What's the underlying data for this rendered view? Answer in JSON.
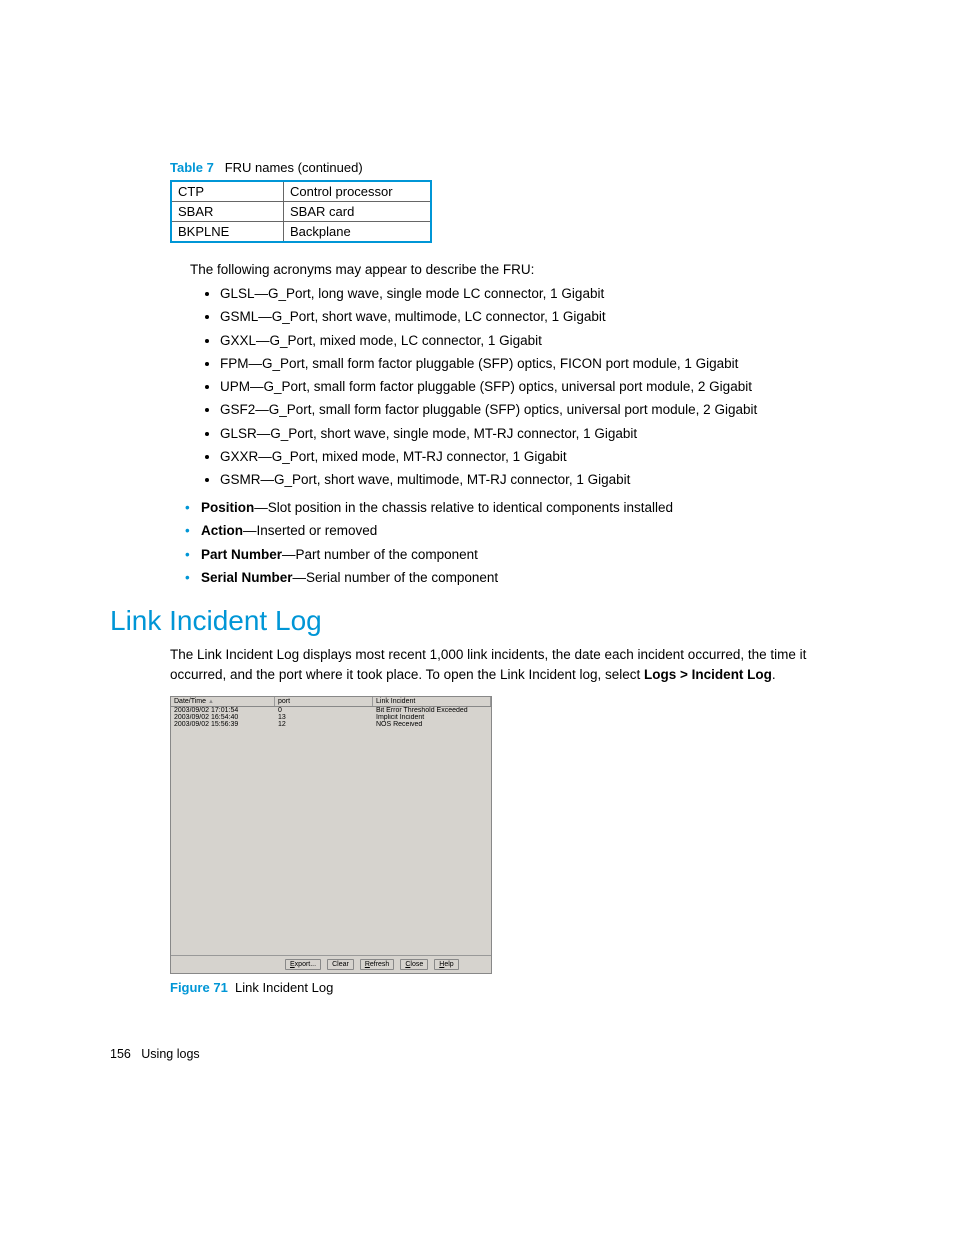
{
  "table": {
    "label": "Table 7",
    "title": "FRU names  (continued)",
    "rows": [
      {
        "k": "CTP",
        "v": "Control processor"
      },
      {
        "k": "SBAR",
        "v": "SBAR card"
      },
      {
        "k": "BKPLNE",
        "v": "Backplane"
      }
    ]
  },
  "intro": "The following acronyms may appear to describe the FRU:",
  "acronyms": [
    "GLSL—G_Port, long wave, single mode LC connector, 1 Gigabit",
    "GSML—G_Port, short wave, multimode, LC connector, 1 Gigabit",
    "GXXL—G_Port, mixed mode, LC connector, 1 Gigabit",
    "FPM—G_Port, small form factor pluggable (SFP) optics, FICON port module, 1 Gigabit",
    "UPM—G_Port, small form factor pluggable (SFP) optics, universal port module, 2 Gigabit",
    "GSF2—G_Port, small form factor pluggable (SFP) optics, universal port module, 2 Gigabit",
    "GLSR—G_Port, short wave, single mode, MT-RJ connector, 1 Gigabit",
    "GXXR—G_Port, mixed mode, MT-RJ connector, 1 Gigabit",
    "GSMR—G_Port, short wave, multimode, MT-RJ connector, 1 Gigabit"
  ],
  "defs": [
    {
      "term": "Position",
      "desc": "—Slot position in the chassis relative to identical components installed"
    },
    {
      "term": "Action",
      "desc": "—Inserted or removed"
    },
    {
      "term": "Part Number",
      "desc": "—Part number of the component"
    },
    {
      "term": "Serial Number",
      "desc": "—Serial number of the component"
    }
  ],
  "section": {
    "title": "Link Incident Log",
    "para_pre": "The Link Incident Log displays most recent 1,000 link incidents, the date each incident occurred, the time it occurred, and the port where it took place. To open the Link Incident log, select ",
    "para_bold": "Logs > Incident Log",
    "para_post": "."
  },
  "log": {
    "headers": {
      "c1": "Date/Time",
      "c2": "port",
      "c3": "Link Incident"
    },
    "rows": [
      {
        "dt": "2003/09/02 17:01:54",
        "port": "0",
        "inc": "Bit Error Threshold Exceeded"
      },
      {
        "dt": "2003/09/02 16:54:40",
        "port": "13",
        "inc": "Implicit Incident"
      },
      {
        "dt": "2003/09/02 15:56:39",
        "port": "12",
        "inc": "NOS Received"
      }
    ],
    "buttons": {
      "export": "Export...",
      "clear": "Clear",
      "refresh": "Refresh",
      "close": "Close",
      "help": "Help"
    }
  },
  "figure": {
    "label": "Figure 71",
    "title": "Link Incident Log"
  },
  "footer": {
    "page": "156",
    "section": "Using logs"
  }
}
